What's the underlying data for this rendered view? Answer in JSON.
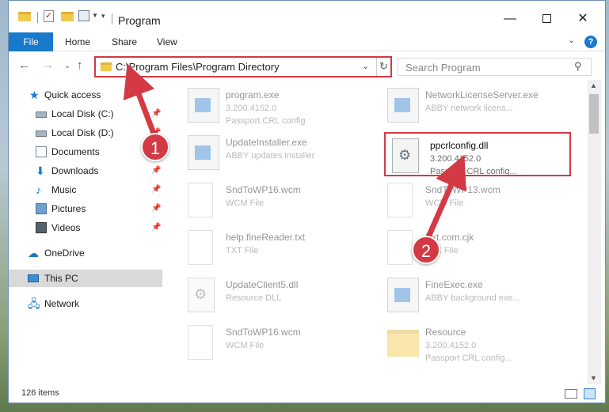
{
  "window": {
    "title": "Program",
    "buttons": {
      "minimize": "—",
      "maximize": "",
      "close": "✕"
    }
  },
  "ribbon": {
    "tabs": [
      "File",
      "Home",
      "Share",
      "View"
    ],
    "expand_icon": "chevron-down-icon",
    "help": "?"
  },
  "nav": {
    "back": "←",
    "forward": "→",
    "recent": "⌄",
    "up": "↑",
    "address": "C:\\Program Files\\Program Directory",
    "address_dropdown": "⌄",
    "refresh": "↻",
    "search_placeholder": "Search Program",
    "search_icon": "⚲"
  },
  "sidebar": {
    "items": [
      {
        "label": "Quick access",
        "icon": "star-icon",
        "pinned": false
      },
      {
        "label": "Local Disk (C:)",
        "icon": "disk-icon",
        "pinned": true
      },
      {
        "label": "Local Disk (D:)",
        "icon": "disk-icon",
        "pinned": true
      },
      {
        "label": "Documents",
        "icon": "documents-icon",
        "pinned": true
      },
      {
        "label": "Downloads",
        "icon": "downloads-icon",
        "pinned": true
      },
      {
        "label": "Music",
        "icon": "music-icon",
        "pinned": true
      },
      {
        "label": "Pictures",
        "icon": "pictures-icon",
        "pinned": true
      },
      {
        "label": "Videos",
        "icon": "videos-icon",
        "pinned": true
      },
      {
        "label": "OneDrive",
        "icon": "cloud-icon",
        "pinned": false
      },
      {
        "label": "This PC",
        "icon": "computer-icon",
        "pinned": false,
        "selected": true
      },
      {
        "label": "Network",
        "icon": "network-icon",
        "pinned": false
      }
    ],
    "pin_glyph": "📌"
  },
  "files": [
    {
      "name": "program.exe",
      "line1": "3.200.4152.0",
      "line2": "Passport CRL config",
      "icon": "application-icon"
    },
    {
      "name": "NetworkLicenseServer.exe",
      "line1": "ABBY network licens...",
      "line2": "",
      "icon": "application-icon"
    },
    {
      "name": "UpdateInstaller.exe",
      "line1": "ABBY updates installer",
      "line2": "",
      "icon": "application-icon"
    },
    {
      "name": "ppcrlconfig.dll",
      "line1": "3.200.4152.0",
      "line2": "Passport CRL config...",
      "icon": "dll-icon",
      "highlighted": true
    },
    {
      "name": "SndToWP16.wcm",
      "line1": "WCM File",
      "line2": "",
      "icon": "page-icon"
    },
    {
      "name": "SndToWP13.wcm",
      "line1": "WCM File",
      "line2": "",
      "icon": "page-icon"
    },
    {
      "name": "help.fineReader.txt",
      "line1": "TXT File",
      "line2": "",
      "icon": "page-icon"
    },
    {
      "name": "Ext.com.cjk",
      "line1": "CJK File",
      "line2": "",
      "icon": "page-icon"
    },
    {
      "name": "UpdateClient5.dll",
      "line1": "Resource DLL",
      "line2": "",
      "icon": "dll-icon"
    },
    {
      "name": "FineExec.exe",
      "line1": "ABBY background exe...",
      "line2": "",
      "icon": "application-icon"
    },
    {
      "name": "SndToWP16.wcm",
      "line1": "WCM File",
      "line2": "",
      "icon": "page-icon"
    },
    {
      "name": "Resource",
      "line1": "3.200.4152.0",
      "line2": "Passport CRL config...",
      "icon": "folder-icon"
    }
  ],
  "scrollbar": {
    "up": "▲",
    "down": "▼"
  },
  "status": {
    "item_count": "126 items"
  },
  "annotations": {
    "step1": "1",
    "step2": "2",
    "color": "#d33a44"
  }
}
